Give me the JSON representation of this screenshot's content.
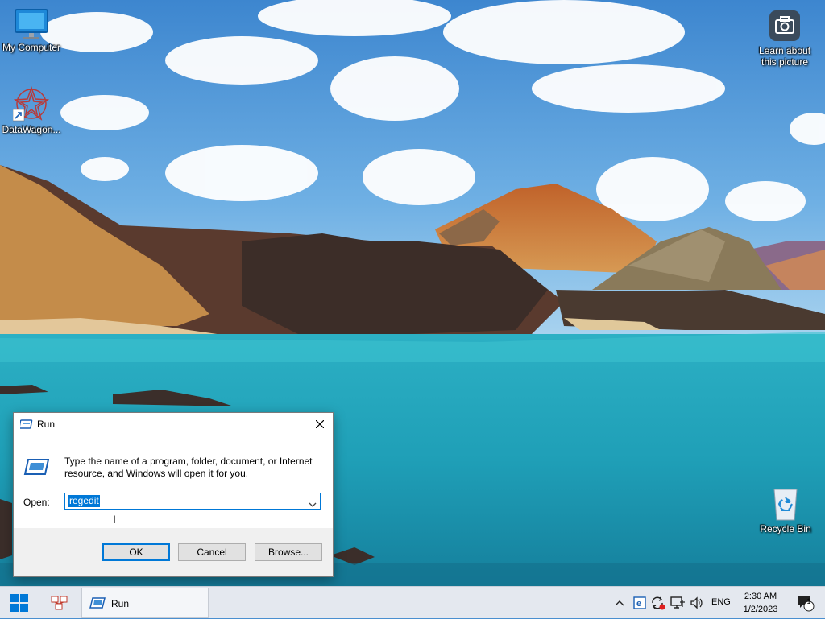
{
  "desktop": {
    "icons": [
      {
        "label": "My Computer"
      },
      {
        "label": "DataWagon..."
      },
      {
        "label": "Learn about this picture"
      },
      {
        "label": "Recycle Bin"
      }
    ]
  },
  "run_dialog": {
    "title": "Run",
    "description": "Type the name of a program, folder, document, or Internet resource, and Windows will open it for you.",
    "open_label": "Open:",
    "open_value": "regedit",
    "ok_label": "OK",
    "cancel_label": "Cancel",
    "browse_label": "Browse..."
  },
  "taskbar": {
    "run_item_label": "Run",
    "language": "ENG",
    "time": "2:30 AM",
    "date": "1/2/2023",
    "notification_count": "1"
  },
  "colors": {
    "accent": "#0078d7",
    "taskbar_bg": "#e4e8ef",
    "dialog_bg": "#f0f0f0"
  }
}
